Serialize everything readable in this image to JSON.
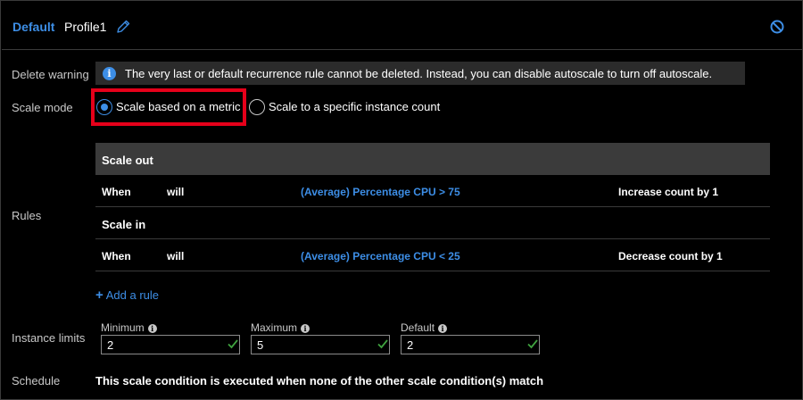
{
  "header": {
    "badge": "Default",
    "profile_name": "Profile1"
  },
  "labels": {
    "delete_warning": "Delete warning",
    "scale_mode": "Scale mode",
    "rules": "Rules",
    "instance_limits": "Instance limits",
    "schedule": "Schedule"
  },
  "warning": {
    "text": "The very last or default recurrence rule cannot be deleted. Instead, you can disable autoscale to turn off autoscale."
  },
  "scale_mode": {
    "options": [
      {
        "label": "Scale based on a metric",
        "selected": true
      },
      {
        "label": "Scale to a specific instance count",
        "selected": false
      }
    ]
  },
  "rules": {
    "scale_out": {
      "title": "Scale out",
      "row": {
        "when": "When",
        "will": "will",
        "metric": "(Average) Percentage CPU > 75",
        "action": "Increase count by 1"
      }
    },
    "scale_in": {
      "title": "Scale in",
      "row": {
        "when": "When",
        "will": "will",
        "metric": "(Average) Percentage CPU < 25",
        "action": "Decrease count by 1"
      }
    },
    "add_rule": "Add a rule"
  },
  "limits": {
    "minimum": {
      "label": "Minimum",
      "value": "2"
    },
    "maximum": {
      "label": "Maximum",
      "value": "5"
    },
    "default": {
      "label": "Default",
      "value": "2"
    }
  },
  "schedule": {
    "text": "This scale condition is executed when none of the other scale condition(s) match"
  },
  "colors": {
    "accent": "#3d8ee6",
    "highlight": "#e6001a",
    "valid": "#3fa33f"
  }
}
